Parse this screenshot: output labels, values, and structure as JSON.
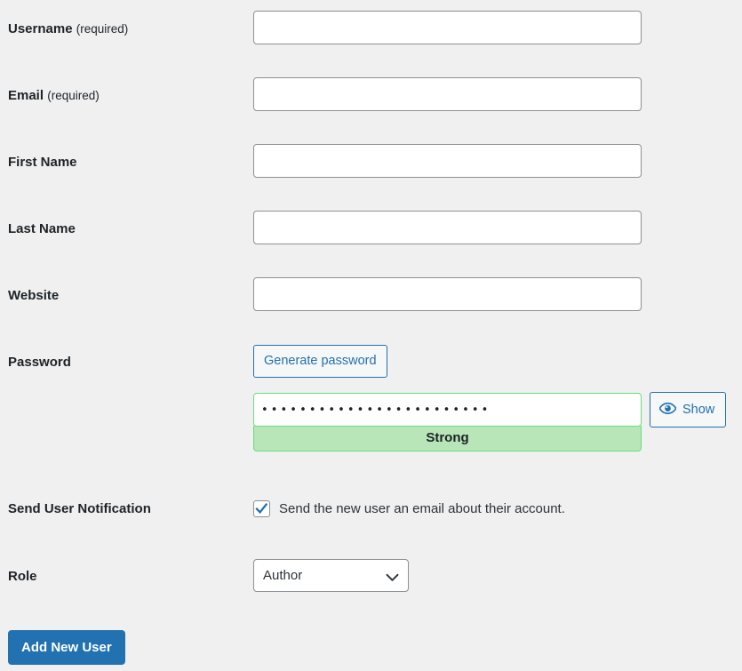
{
  "colors": {
    "page_background": "#f0f0f1",
    "label_text": "#1d2327",
    "accent_blue": "#2271b1",
    "input_border": "#8c8f94",
    "strength_border": "#68de7c",
    "strength_fill": "#b8e6b8",
    "button_text_white": "#ffffff"
  },
  "form": {
    "rows": {
      "username": {
        "label": "Username",
        "required_suffix": "(required)",
        "value": "",
        "placeholder": ""
      },
      "email": {
        "label": "Email",
        "required_suffix": "(required)",
        "value": "",
        "placeholder": ""
      },
      "first_name": {
        "label": "First Name",
        "value": "",
        "placeholder": ""
      },
      "last_name": {
        "label": "Last Name",
        "value": "",
        "placeholder": ""
      },
      "website": {
        "label": "Website",
        "value": "",
        "placeholder": ""
      },
      "password": {
        "label": "Password",
        "generate_button_label": "Generate password",
        "masked_value": "••••••••••••••••••••••••",
        "show_button_label": "Show",
        "show_button_icon": "eye-icon",
        "strength_label": "Strong"
      },
      "send_user_notification": {
        "label": "Send User Notification",
        "checkbox_label": "Send the new user an email about their account.",
        "checked": true,
        "check_icon": "checkmark-icon"
      },
      "role": {
        "label": "Role",
        "selected_value": "Author",
        "arrow_icon": "chevron-down-icon"
      }
    },
    "submit_button_label": "Add New User"
  }
}
